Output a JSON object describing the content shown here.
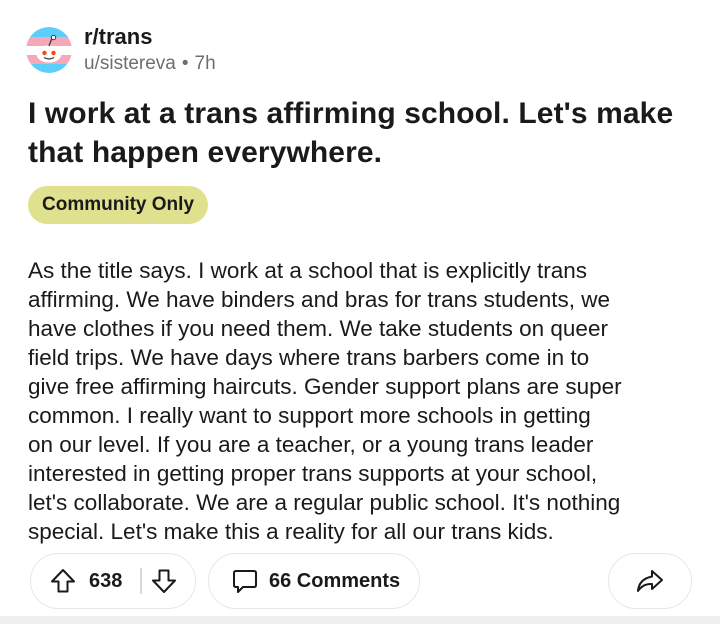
{
  "post": {
    "subreddit": "r/trans",
    "author": "u/sistereva",
    "separator": "•",
    "time_ago": "7h",
    "title": "I work at a trans affirming school. Let's make that happen everywhere.",
    "flair": "Community Only",
    "body_lines": [
      "As the title says. I work at a school that is explicitly trans",
      "affirming. We have binders and bras for trans students, we",
      "have clothes if you need them. We take students on queer",
      "field trips. We have days where trans barbers come in to",
      "give free affirming haircuts. Gender support plans are super",
      "common. I really want to support more schools in getting",
      "on our level. If you are a teacher, or a young trans leader",
      "interested in getting proper trans supports at your school,",
      "let's collaborate. We are a regular public school. It's nothing",
      "special. Let's make this a reality for all our trans kids."
    ]
  },
  "actions": {
    "vote_count": "638",
    "comments_label": "66 Comments"
  },
  "icons": {
    "avatar": "trans-flag-snoo-icon",
    "upvote": "arrow-up-icon",
    "downvote": "arrow-down-icon",
    "comments": "speech-bubble-icon",
    "share": "share-arrow-icon"
  },
  "colors": {
    "flair_bg": "#dfe18e",
    "trans_blue": "#5bcefa",
    "trans_pink": "#f5a9b8",
    "meta_gray": "#6b6f73"
  }
}
